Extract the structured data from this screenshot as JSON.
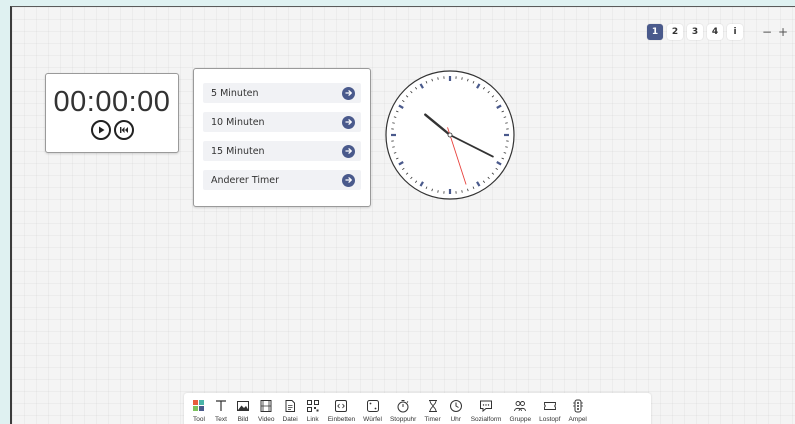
{
  "pagination": {
    "pages": [
      "1",
      "2",
      "3",
      "4"
    ],
    "active": "1",
    "info_label": "i",
    "zoom_out": "−",
    "zoom_in": "+"
  },
  "stopwatch": {
    "time": "00:00:00",
    "play_icon": "play-icon",
    "reset_icon": "rewind-icon"
  },
  "timers": {
    "items": [
      "5 Minuten",
      "10 Minuten",
      "15 Minuten",
      "Anderer Timer"
    ],
    "arrow_icon": "arrow-right-icon"
  },
  "clock": {
    "time_shown": "10:19:27"
  },
  "colors": {
    "accent": "#4a5a8c",
    "second_hand": "#e8413c",
    "board": "#f4f4f4",
    "background": "#dff1f1"
  },
  "toolbar": {
    "tools": [
      {
        "label": "Tool",
        "icon": "tool-logo-icon"
      },
      {
        "label": "Text",
        "icon": "text-icon"
      },
      {
        "label": "Bild",
        "icon": "image-icon"
      },
      {
        "label": "Video",
        "icon": "video-icon"
      },
      {
        "label": "Datei",
        "icon": "file-icon"
      },
      {
        "label": "Link",
        "icon": "qr-code-icon"
      },
      {
        "label": "Einbetten",
        "icon": "embed-icon"
      },
      {
        "label": "Würfel",
        "icon": "dice-icon"
      },
      {
        "label": "Stoppuhr",
        "icon": "stopwatch-icon"
      },
      {
        "label": "Timer",
        "icon": "hourglass-icon"
      },
      {
        "label": "Uhr",
        "icon": "clock-icon"
      },
      {
        "label": "Sozialform",
        "icon": "speech-bubble-icon"
      },
      {
        "label": "Gruppe",
        "icon": "group-icon"
      },
      {
        "label": "Lostopf",
        "icon": "ticket-icon"
      },
      {
        "label": "Ampel",
        "icon": "traffic-light-icon"
      }
    ]
  }
}
